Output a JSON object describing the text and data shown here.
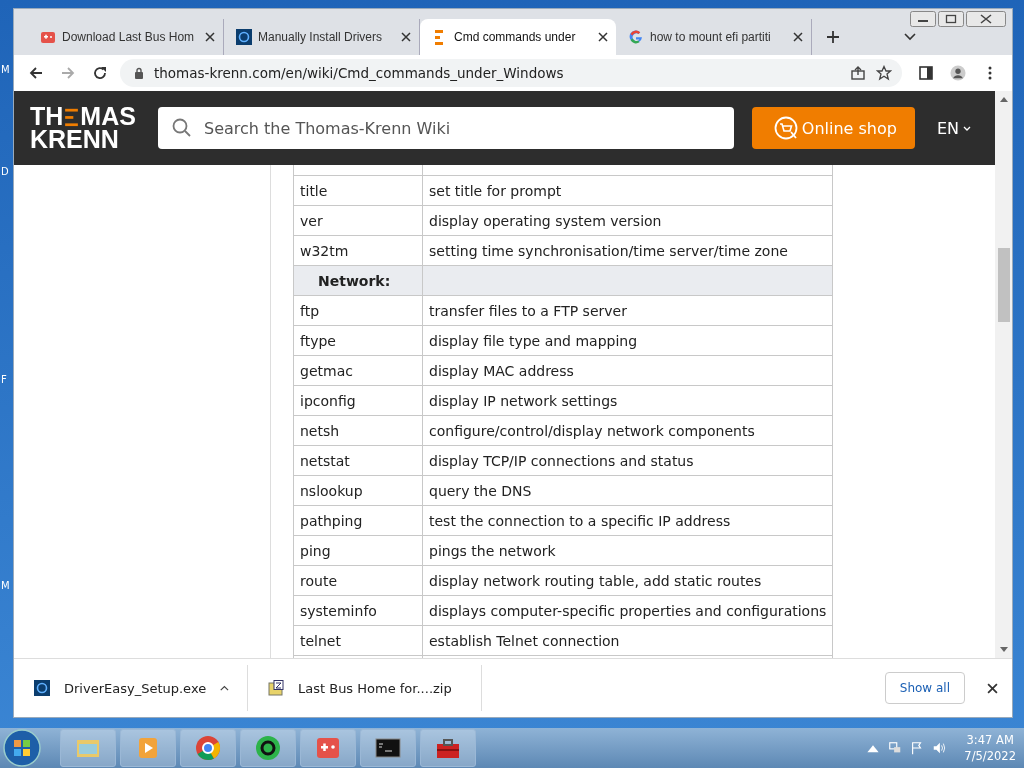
{
  "desktop_labels": [
    "M",
    "D",
    "F",
    "M"
  ],
  "tabs": [
    {
      "title": "Download Last Bus Hom",
      "selected": false
    },
    {
      "title": "Manually Install Drivers",
      "selected": false
    },
    {
      "title": "Cmd commands under",
      "selected": true
    },
    {
      "title": "how to mount efi partiti",
      "selected": false
    }
  ],
  "address": {
    "url": "thomas-krenn.com/en/wiki/Cmd_commands_under_Windows"
  },
  "site_header": {
    "logo": {
      "top_left": "TH",
      "top_right": "MAS",
      "bottom": "KRENN"
    },
    "search": {
      "placeholder": "Search the Thomas-Krenn Wiki"
    },
    "shop_button": "Online shop",
    "language": "EN"
  },
  "table": {
    "rows": [
      {
        "kind": "row",
        "command": "title",
        "description": "set title for prompt"
      },
      {
        "kind": "row",
        "command": "ver",
        "description": "display operating system version"
      },
      {
        "kind": "row",
        "command": "w32tm",
        "description": "setting time synchronisation/time server/time zone"
      },
      {
        "kind": "section",
        "command": "Network:",
        "description": ""
      },
      {
        "kind": "row",
        "command": "ftp",
        "description": "transfer files to a FTP server"
      },
      {
        "kind": "row",
        "command": "ftype",
        "description": "display file type and mapping"
      },
      {
        "kind": "row",
        "command": "getmac",
        "description": "display MAC address"
      },
      {
        "kind": "row",
        "command": "ipconfig",
        "description": "display IP network settings"
      },
      {
        "kind": "row",
        "command": "netsh",
        "description": "configure/control/display network components"
      },
      {
        "kind": "row",
        "command": "netstat",
        "description": "display TCP/IP connections and status"
      },
      {
        "kind": "row",
        "command": "nslookup",
        "description": "query the DNS"
      },
      {
        "kind": "row",
        "command": "pathping",
        "description": "test the connection to a specific IP address"
      },
      {
        "kind": "row",
        "command": "ping",
        "description": "pings the network"
      },
      {
        "kind": "row",
        "command": "route",
        "description": "display network routing table, add static routes"
      },
      {
        "kind": "row",
        "command": "systeminfo",
        "description": "displays computer-specific properties and configurations"
      },
      {
        "kind": "row",
        "command": "telnet",
        "description": "establish Telnet connection"
      }
    ]
  },
  "downloads": {
    "items": [
      {
        "name": "DriverEasy_Setup.exe"
      },
      {
        "name": "Last Bus Home for....zip"
      }
    ],
    "show_all": "Show all"
  },
  "taskbar": {
    "time": "3:47 AM",
    "date": "7/5/2022"
  }
}
